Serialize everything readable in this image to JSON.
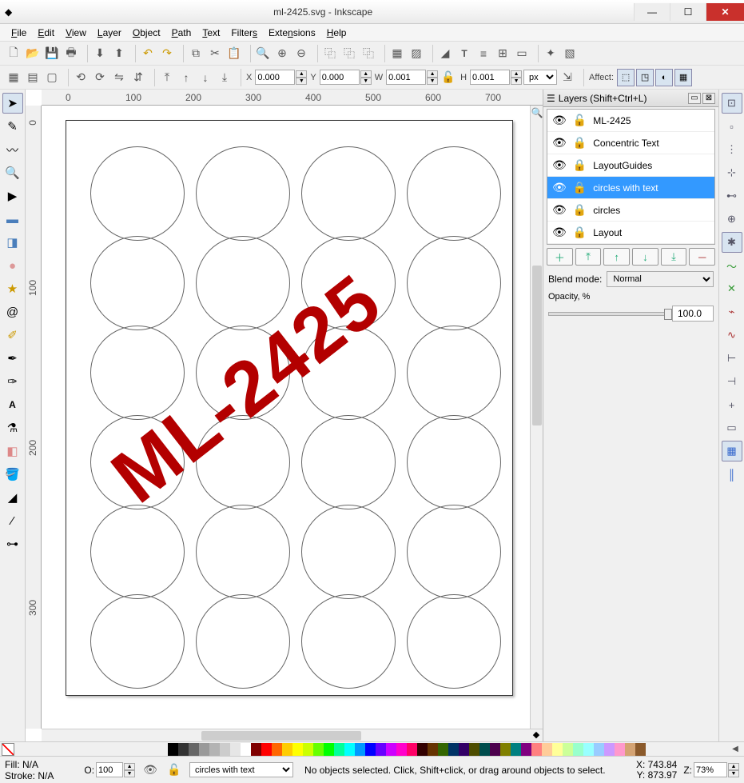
{
  "window": {
    "title": "ml-2425.svg - Inkscape"
  },
  "menu": [
    "File",
    "Edit",
    "View",
    "Layer",
    "Object",
    "Path",
    "Text",
    "Filters",
    "Extensions",
    "Help"
  ],
  "coords": {
    "x": "0.000",
    "y": "0.000",
    "w": "0.001",
    "h": "0.001",
    "unit": "px",
    "affect_label": "Affect:"
  },
  "ruler_marks_h": [
    "0",
    "100",
    "200",
    "300",
    "400",
    "500",
    "600",
    "700"
  ],
  "ruler_marks_v": [
    "0",
    "100",
    "200",
    "300"
  ],
  "canvas_text": "ML-2425",
  "layers_panel": {
    "title": "Layers (Shift+Ctrl+L)",
    "items": [
      {
        "name": "ML-2425",
        "locked": false
      },
      {
        "name": "Concentric Text",
        "locked": true
      },
      {
        "name": "LayoutGuides",
        "locked": true
      },
      {
        "name": "circles with text",
        "locked": true,
        "selected": true
      },
      {
        "name": "circles",
        "locked": true
      },
      {
        "name": "Layout",
        "locked": true
      }
    ],
    "blend_label": "Blend mode:",
    "blend_value": "Normal",
    "opacity_label": "Opacity, %",
    "opacity_value": "100.0"
  },
  "status": {
    "fill_label": "Fill:",
    "fill_value": "N/A",
    "stroke_label": "Stroke:",
    "stroke_value": "N/A",
    "o_label": "O:",
    "o_value": "100",
    "layer_name": "circles with text",
    "message": "No objects selected. Click, Shift+click, or drag around objects to select.",
    "x_label": "X:",
    "x_value": "743.84",
    "y_label": "Y:",
    "y_value": "873.97",
    "z_label": "Z:",
    "z_value": "73%"
  },
  "palette": [
    "#000000",
    "#333333",
    "#666666",
    "#999999",
    "#b3b3b3",
    "#cccccc",
    "#e6e6e6",
    "#ffffff",
    "#800000",
    "#ff0000",
    "#ff6600",
    "#ffcc00",
    "#ffff00",
    "#ccff00",
    "#66ff00",
    "#00ff00",
    "#00ff99",
    "#00ffff",
    "#0099ff",
    "#0000ff",
    "#6600ff",
    "#cc00ff",
    "#ff00cc",
    "#ff0066",
    "#330000",
    "#663300",
    "#336600",
    "#003366",
    "#330066",
    "#4d4d00",
    "#004d4d",
    "#4d004d",
    "#808000",
    "#008080",
    "#800080",
    "#ff8080",
    "#ffcc99",
    "#ffff99",
    "#ccff99",
    "#99ffcc",
    "#99ffff",
    "#99ccff",
    "#cc99ff",
    "#ff99cc",
    "#d4a373",
    "#8b5a2b"
  ]
}
